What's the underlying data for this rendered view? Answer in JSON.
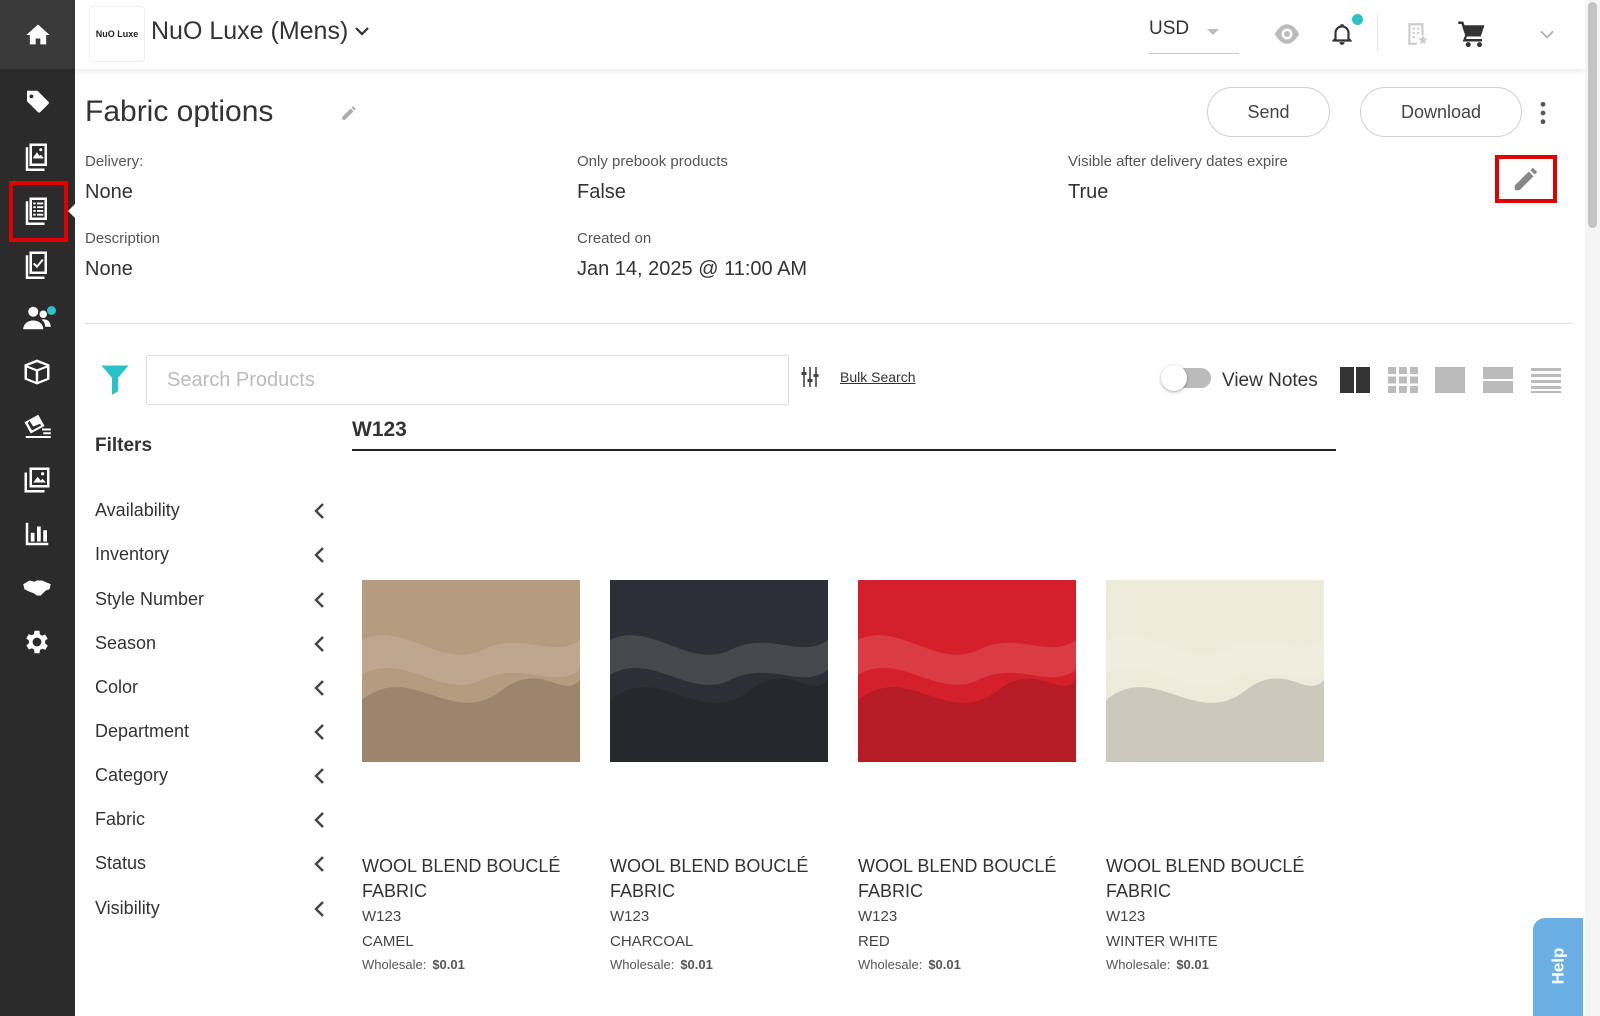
{
  "topbar": {
    "logo_text": "NuO Luxe",
    "brand": "NuO Luxe (Mens)",
    "currency": "USD"
  },
  "page": {
    "title": "Fabric options",
    "send_label": "Send",
    "download_label": "Download"
  },
  "meta": {
    "delivery_label": "Delivery:",
    "delivery_value": "None",
    "prebook_label": "Only prebook products",
    "prebook_value": "False",
    "visible_label": "Visible after delivery dates expire",
    "visible_value": "True",
    "description_label": "Description",
    "description_value": "None",
    "created_label": "Created on",
    "created_value": "Jan 14, 2025 @ 11:00 AM"
  },
  "search": {
    "placeholder": "Search Products",
    "bulk_label": "Bulk Search",
    "view_notes_label": "View Notes"
  },
  "filters": {
    "title": "Filters",
    "items": [
      "Availability",
      "Inventory",
      "Style Number",
      "Season",
      "Color",
      "Department",
      "Category",
      "Fabric",
      "Status",
      "Visibility"
    ]
  },
  "group": {
    "title": "W123"
  },
  "products": [
    {
      "name": "WOOL BLEND BOUCLÉ FABRIC",
      "sku": "W123",
      "color": "CAMEL",
      "price_label": "Wholesale:",
      "price": "$0.01",
      "swatch": "#b59b7f"
    },
    {
      "name": "WOOL BLEND BOUCLÉ FABRIC",
      "sku": "W123",
      "color": "CHARCOAL",
      "price_label": "Wholesale:",
      "price": "$0.01",
      "swatch": "#2e2f36"
    },
    {
      "name": "WOOL BLEND BOUCLÉ FABRIC",
      "sku": "W123",
      "color": "RED",
      "price_label": "Wholesale:",
      "price": "$0.01",
      "swatch": "#d5202c"
    },
    {
      "name": "WOOL BLEND BOUCLÉ FABRIC",
      "sku": "W123",
      "color": "WINTER WHITE",
      "price_label": "Wholesale:",
      "price": "$0.01",
      "swatch": "#eeebdb"
    }
  ],
  "help": {
    "label": "Help"
  },
  "colors": {
    "accent_teal": "#27c3c9",
    "rail_bg": "#2b2b2b",
    "highlight_red": "#e10000",
    "help_blue": "#6ab0e4"
  }
}
